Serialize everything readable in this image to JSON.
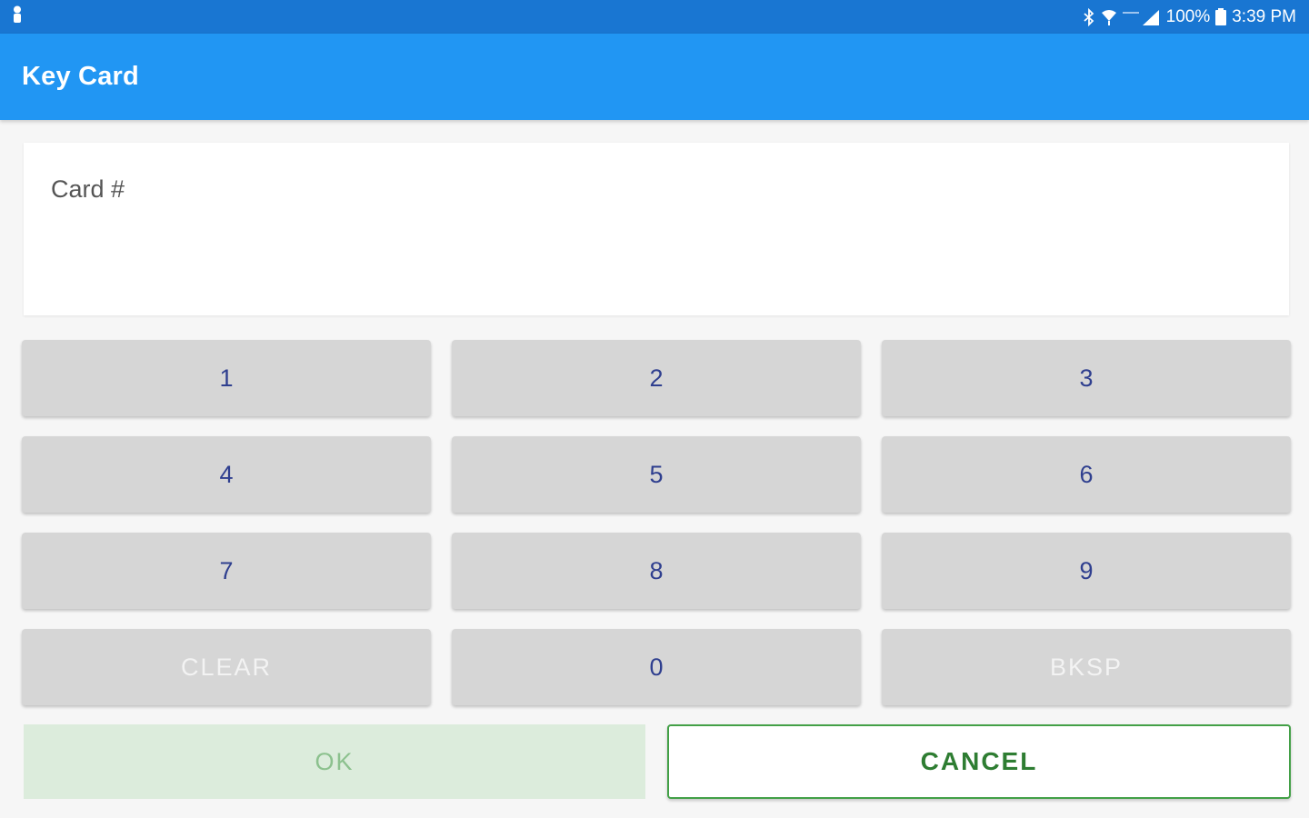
{
  "status_bar": {
    "left_icon": "person-notification-icon",
    "icons": [
      "bluetooth-icon",
      "wifi-icon",
      "cell-signal-icon",
      "battery-icon"
    ],
    "battery_text": "100%",
    "time": "3:39 PM"
  },
  "app_bar": {
    "title": "Key Card"
  },
  "card_field": {
    "label": "Card #",
    "value": ""
  },
  "keypad": {
    "keys": [
      "1",
      "2",
      "3",
      "4",
      "5",
      "6",
      "7",
      "8",
      "9",
      "CLEAR",
      "0",
      "BKSP"
    ]
  },
  "actions": {
    "ok_label": "OK",
    "cancel_label": "CANCEL"
  },
  "colors": {
    "status_bar": "#1976d2",
    "app_bar": "#2196f3",
    "key_background": "#d6d6d6",
    "key_text": "#2f3f8f",
    "ok_background": "#dcecdc",
    "cancel_border": "#43a047",
    "cancel_text": "#2e7d32"
  }
}
